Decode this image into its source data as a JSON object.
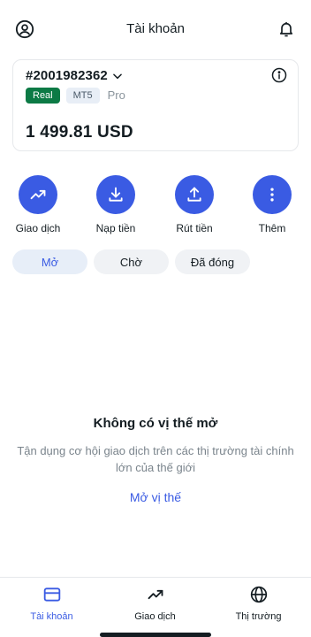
{
  "header": {
    "title": "Tài khoản",
    "left_icon": "user-circle-icon",
    "right_icon": "bell-icon"
  },
  "account": {
    "number": "#2001982362",
    "badges": {
      "type": "Real",
      "platform": "MT5",
      "tier": "Pro"
    },
    "balance": "1 499.81 USD"
  },
  "actions": [
    {
      "label": "Giao dịch",
      "icon": "trend-up-icon"
    },
    {
      "label": "Nạp tiền",
      "icon": "download-icon"
    },
    {
      "label": "Rút tiền",
      "icon": "upload-icon"
    },
    {
      "label": "Thêm",
      "icon": "more-vertical-icon"
    }
  ],
  "tabs": [
    {
      "label": "Mở",
      "active": true
    },
    {
      "label": "Chờ",
      "active": false
    },
    {
      "label": "Đã đóng",
      "active": false
    }
  ],
  "empty_state": {
    "title": "Không có vị thế mở",
    "description": "Tận dụng cơ hội giao dịch trên các thị trường tài chính lớn của thế giới",
    "link": "Mở vị thế"
  },
  "bottom_nav": [
    {
      "label": "Tài khoản",
      "icon": "card-icon",
      "active": true
    },
    {
      "label": "Giao dịch",
      "icon": "trend-up-icon",
      "active": false
    },
    {
      "label": "Thị trường",
      "icon": "globe-icon",
      "active": false
    }
  ],
  "colors": {
    "accent": "#3a5be3",
    "real_badge": "#0c7a45",
    "text": "#141d22",
    "muted": "#7a848c"
  }
}
